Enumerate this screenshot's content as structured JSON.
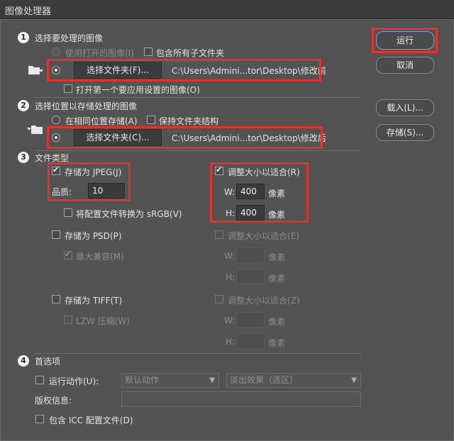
{
  "window": {
    "title": "图像处理器"
  },
  "actions": {
    "run": "运行",
    "cancel": "取消",
    "load": "载入(L)...",
    "save": "存储(S)..."
  },
  "section1": {
    "number": "1",
    "title": "选择要处理的图像",
    "use_open_images": "使用打开的图像(I)",
    "include_subfolders": "包含所有子文件夹",
    "select_folder": "选择文件夹(F)...",
    "path": "C:\\Users\\Admini...tor\\Desktop\\修改前",
    "open_first": "打开第一个要应用设置的图像(O)"
  },
  "section2": {
    "number": "2",
    "title": "选择位置以存储处理的图像",
    "same_location": "在相同位置存储(A)",
    "keep_structure": "保持文件夹结构",
    "select_folder": "选择文件夹(C)...",
    "path": "C:\\Users\\Admini...tor\\Desktop\\修改后"
  },
  "section3": {
    "number": "3",
    "title": "文件类型",
    "jpeg": {
      "save_as": "存储为 JPEG(J)",
      "quality_label": "品质:",
      "quality_value": "10",
      "convert_srgb": "将配置文件转换为 sRGB(V)",
      "resize": "调整大小以适合(R)",
      "w_label": "W:",
      "w_value": "400",
      "h_label": "H:",
      "h_value": "400",
      "unit": "像素"
    },
    "psd": {
      "save_as": "存储为 PSD(P)",
      "max_compat": "最大兼容(M)",
      "resize": "调整大小以适合(E)",
      "w_label": "W:",
      "h_label": "H:",
      "unit": "像素"
    },
    "tiff": {
      "save_as": "存储为 TIFF(T)",
      "lzw": "LZW 压缩(W)",
      "resize": "调整大小以适合(Z)",
      "w_label": "W:",
      "h_label": "H:",
      "unit": "像素"
    }
  },
  "section4": {
    "number": "4",
    "title": "首选项",
    "run_action": "运行动作(U):",
    "action_set": "默认动作",
    "action": "淡出效果（选区）",
    "copyright_label": "版权信息:",
    "copyright_value": "",
    "include_icc": "包含 ICC 配置文件(D)"
  },
  "colors": {
    "highlight": "#e0322f",
    "dialog_bg": "#535353"
  }
}
